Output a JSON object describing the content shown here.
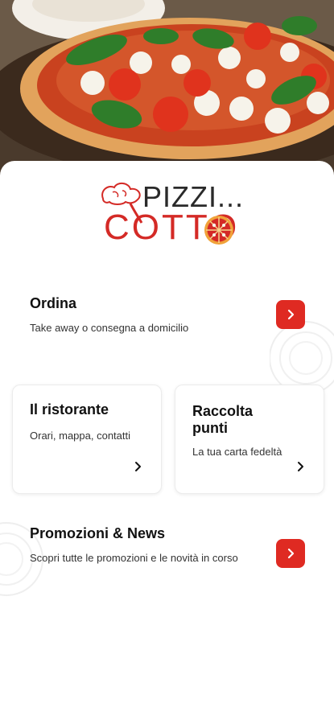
{
  "logo": {
    "line1": "PIZZI...",
    "line2": "COTTO"
  },
  "ordina": {
    "title": "Ordina",
    "subtitle": "Take away o consegna a domicilio",
    "icon": "chevron-right-icon"
  },
  "ristorante": {
    "title": "Il ristorante",
    "subtitle": "Orari, mappa, contatti",
    "icon": "chevron-right-icon"
  },
  "punti": {
    "title": "Raccolta punti",
    "subtitle": "La tua carta fedeltà",
    "icon": "chevron-right-icon"
  },
  "promo": {
    "title": "Promozioni & News",
    "subtitle": "Scopri tutte le promozioni e le novità in corso",
    "icon": "chevron-right-icon"
  },
  "colors": {
    "accent": "#df2a22",
    "logo_red": "#d42a26"
  }
}
